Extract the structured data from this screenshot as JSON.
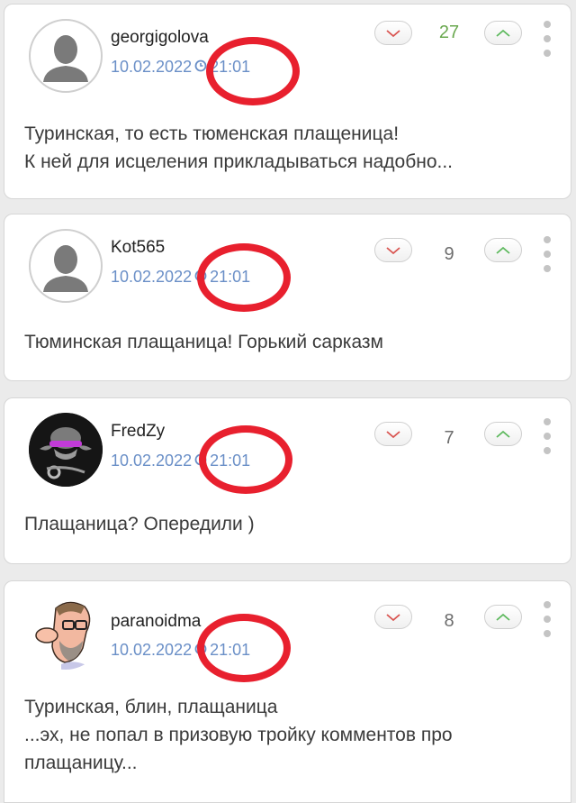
{
  "comments": [
    {
      "username": "georgigolova",
      "date": "10.02.2022",
      "time": "21:01",
      "score": "27",
      "text": "Туринская, то есть тюменская плащеница!\nК ней для исцеления прикладываться надобно..."
    },
    {
      "username": "Kot565",
      "date": "10.02.2022",
      "time": "21:01",
      "score": "9",
      "text": "Тюминская плащаница!  Горький сарказм"
    },
    {
      "username": "FredZy",
      "date": "10.02.2022",
      "time": "21:01",
      "score": "7",
      "text": "Плащаница? Опередили )"
    },
    {
      "username": "paranoidma",
      "date": "10.02.2022",
      "time": "21:01",
      "score": "8",
      "text": "Туринская, блин, плащаница\n...эх, не попал в призовую тройку комментов про плащаницу..."
    }
  ],
  "colors": {
    "positive_score": "#6aa84f",
    "neutral_score": "#6d6d6d",
    "date_link": "#6a8fc7",
    "downvote_arrow": "#d9534f",
    "upvote_arrow": "#5cb85c",
    "annotation_circle": "#e8202e"
  },
  "icons": {
    "downvote": "chevron-down-icon",
    "upvote": "chevron-up-icon",
    "menu": "vertical-ellipsis-icon",
    "time": "clock-icon",
    "default_avatar": "user-silhouette-icon"
  }
}
